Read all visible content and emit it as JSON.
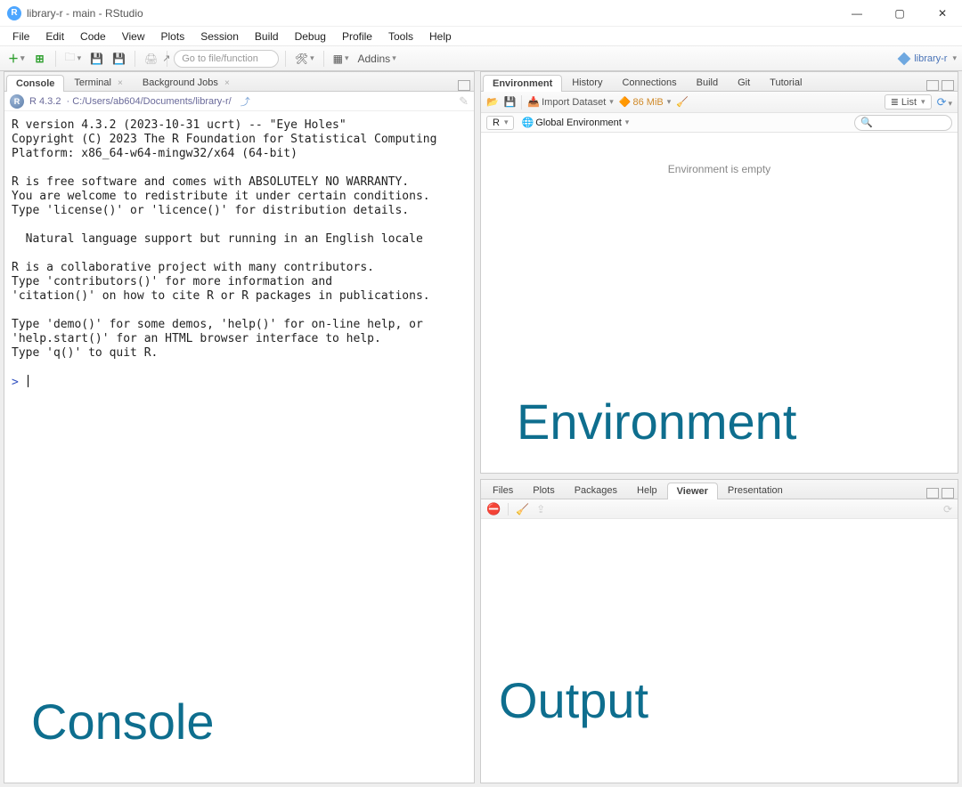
{
  "window": {
    "title": "library-r - main - RStudio",
    "project_name": "library-r"
  },
  "menubar": [
    "File",
    "Edit",
    "Code",
    "View",
    "Plots",
    "Session",
    "Build",
    "Debug",
    "Profile",
    "Tools",
    "Help"
  ],
  "toolbar": {
    "goto_placeholder": "Go to file/function",
    "addins_label": "Addins"
  },
  "left_pane": {
    "tabs": [
      {
        "label": "Console",
        "active": true,
        "closable": false
      },
      {
        "label": "Terminal",
        "active": false,
        "closable": true
      },
      {
        "label": "Background Jobs",
        "active": false,
        "closable": true
      }
    ],
    "path_version": "R 4.3.2",
    "path_dir": "· C:/Users/ab604/Documents/library-r/",
    "console_text": "R version 4.3.2 (2023-10-31 ucrt) -- \"Eye Holes\"\nCopyright (C) 2023 The R Foundation for Statistical Computing\nPlatform: x86_64-w64-mingw32/x64 (64-bit)\n\nR is free software and comes with ABSOLUTELY NO WARRANTY.\nYou are welcome to redistribute it under certain conditions.\nType 'license()' or 'licence()' for distribution details.\n\n  Natural language support but running in an English locale\n\nR is a collaborative project with many contributors.\nType 'contributors()' for more information and\n'citation()' on how to cite R or R packages in publications.\n\nType 'demo()' for some demos, 'help()' for on-line help, or\n'help.start()' for an HTML browser interface to help.\nType 'q()' to quit R.\n",
    "prompt": "> "
  },
  "env_pane": {
    "tabs": [
      "Environment",
      "History",
      "Connections",
      "Build",
      "Git",
      "Tutorial"
    ],
    "active_tab": 0,
    "import_label": "Import Dataset",
    "memory_label": "86 MiB",
    "view_label": "List",
    "scope_lang": "R",
    "scope_env": "Global Environment",
    "empty_text": "Environment is empty"
  },
  "out_pane": {
    "tabs": [
      "Files",
      "Plots",
      "Packages",
      "Help",
      "Viewer",
      "Presentation"
    ],
    "active_tab": 4
  },
  "annotations": {
    "console": "Console",
    "environment": "Environment",
    "output": "Output"
  }
}
